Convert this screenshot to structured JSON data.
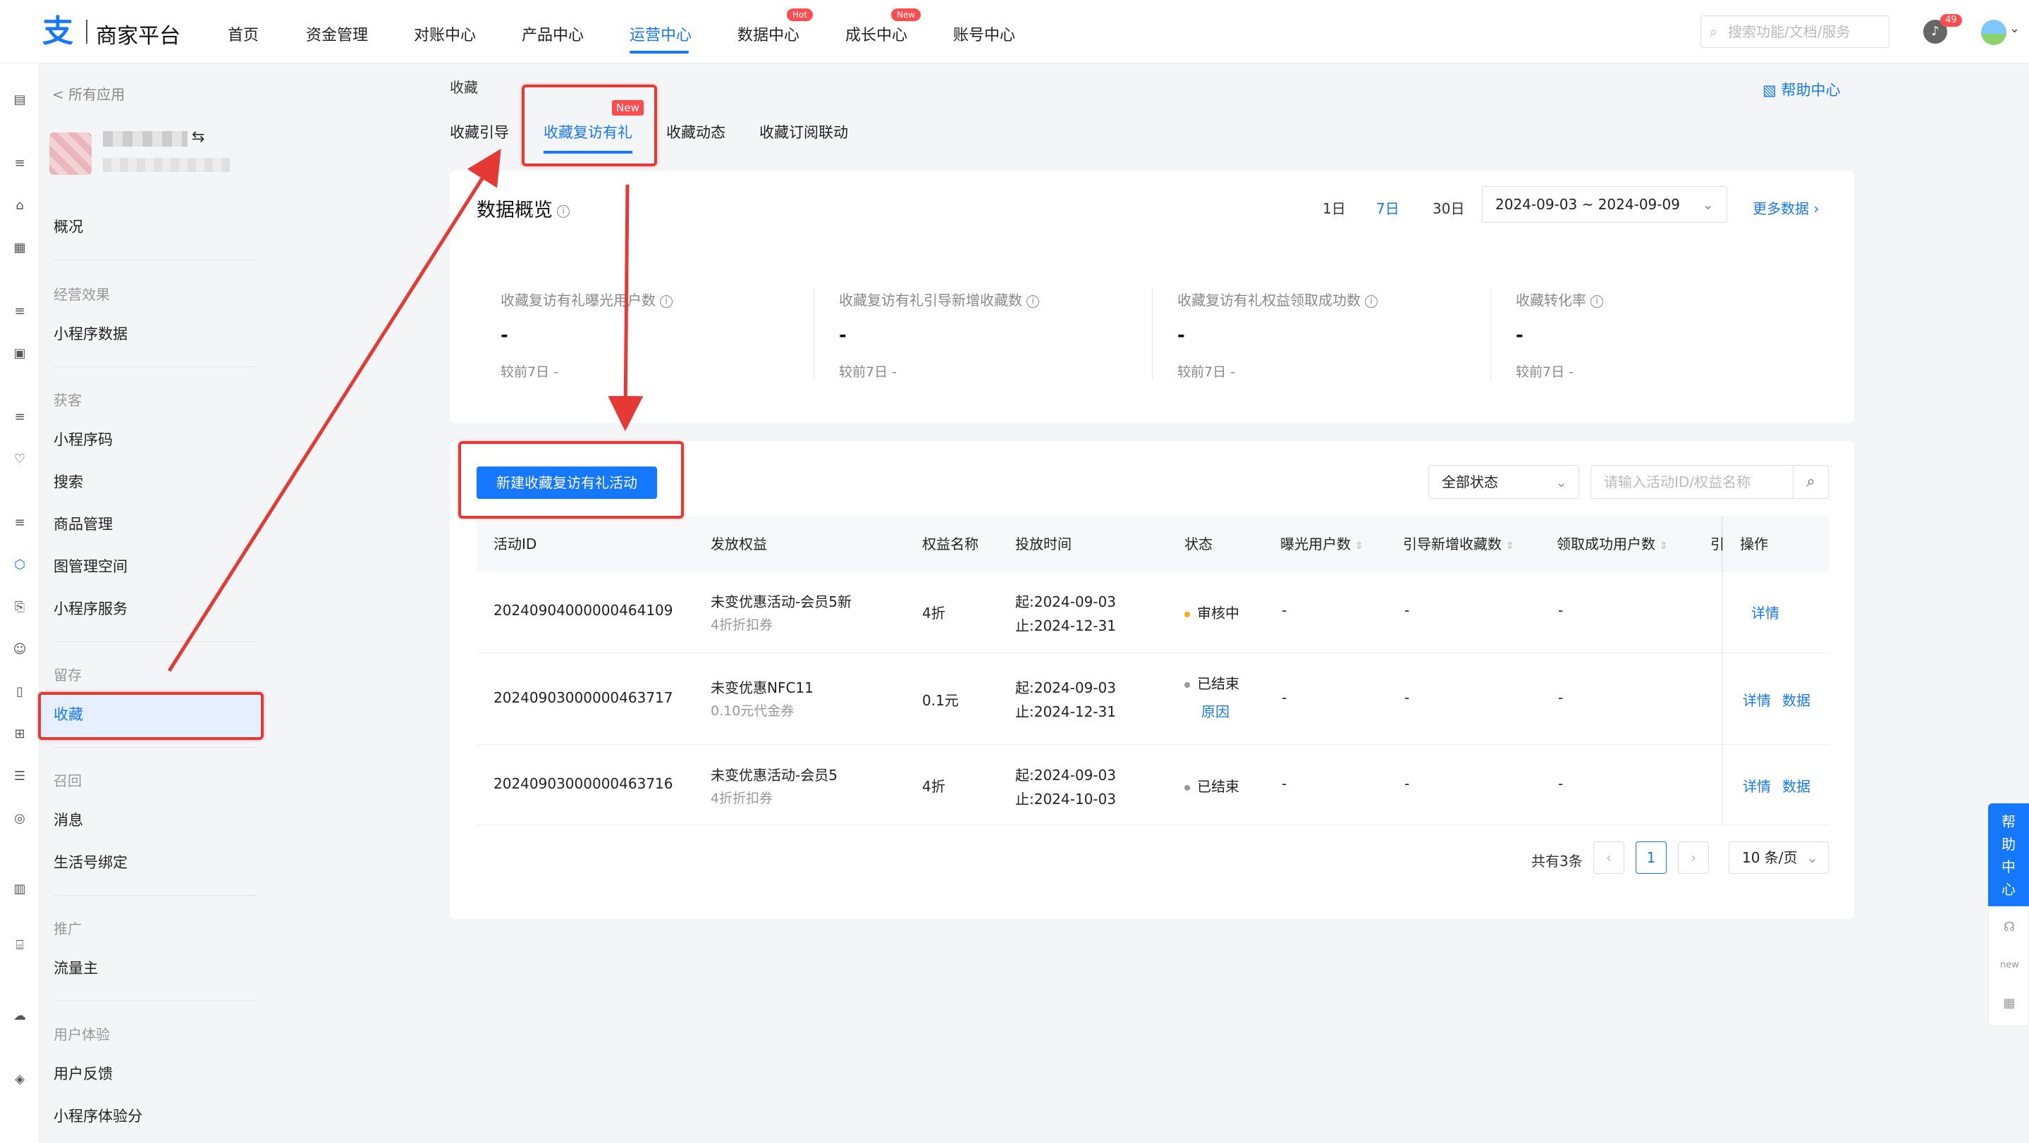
{
  "brand": {
    "mark": "支",
    "name": "商家平台",
    "color": "#1677ff"
  },
  "nav": {
    "items": [
      "首页",
      "资金管理",
      "对账中心",
      "产品中心",
      "运营中心",
      "数据中心",
      "成长中心",
      "账号中心"
    ],
    "active": "运营中心",
    "badges": {
      "data_center": "Hot",
      "growth_center": "New"
    }
  },
  "top": {
    "search_placeholder": "搜索功能/文档/服务",
    "notification_count": "49"
  },
  "sidebar": {
    "back": "< 所有应用",
    "overview": "概况",
    "groups": {
      "effect": {
        "title": "经营效果",
        "items": [
          "小程序数据"
        ]
      },
      "acquire": {
        "title": "获客",
        "items": [
          "小程序码",
          "搜索",
          "商品管理",
          "图管理空间",
          "小程序服务"
        ]
      },
      "retain": {
        "title": "留存",
        "items": [
          "收藏"
        ]
      },
      "recall": {
        "title": "召回",
        "items": [
          "消息",
          "生活号绑定"
        ]
      },
      "promote": {
        "title": "推广",
        "items": [
          "流量主"
        ]
      },
      "ux": {
        "title": "用户体验",
        "items": [
          "用户反馈",
          "小程序体验分"
        ]
      }
    },
    "active": "收藏"
  },
  "page": {
    "title": "收藏",
    "tabs": [
      "收藏引导",
      "收藏复访有礼",
      "收藏动态",
      "收藏订阅联动"
    ],
    "active_tab": "收藏复访有礼",
    "tab_badge": "New",
    "help": "帮助中心"
  },
  "overview": {
    "title": "数据概览",
    "ranges": [
      "1日",
      "7日",
      "30日"
    ],
    "active_range": "7日",
    "date_range": "2024-09-03 ~ 2024-09-09",
    "more": "更多数据",
    "metrics": [
      {
        "label": "收藏复访有礼曝光用户数",
        "value": "-",
        "compare": "较前7日 -"
      },
      {
        "label": "收藏复访有礼引导新增收藏数",
        "value": "-",
        "compare": "较前7日 -"
      },
      {
        "label": "收藏复访有礼权益领取成功数",
        "value": "-",
        "compare": "较前7日 -"
      },
      {
        "label": "收藏转化率",
        "value": "-",
        "compare": "较前7日 -"
      }
    ]
  },
  "activities": {
    "create_button": "新建收藏复访有礼活动",
    "status_filter": "全部状态",
    "search_placeholder": "请输入活动ID/权益名称",
    "columns": [
      "活动ID",
      "发放权益",
      "权益名称",
      "投放时间",
      "状态",
      "曝光用户数",
      "引导新增收藏数",
      "领取成功用户数",
      "引",
      "操作"
    ],
    "rows": [
      {
        "id": "20240904000000464109",
        "benefit": "未变优惠活动-会员5新",
        "benefit_sub": "4折折扣券",
        "name": "4折",
        "start": "起:2024-09-03",
        "end": "止:2024-12-31",
        "status": "审核中",
        "status_color": "#faad14",
        "reason": "",
        "exposure": "-",
        "new_fav": "-",
        "claimed": "-",
        "actions": [
          "详情"
        ]
      },
      {
        "id": "20240903000000463717",
        "benefit": "未变优惠NFC11",
        "benefit_sub": "0.10元代金券",
        "name": "0.1元",
        "start": "起:2024-09-03",
        "end": "止:2024-12-31",
        "status": "已结束",
        "status_color": "#999999",
        "reason": "原因",
        "exposure": "-",
        "new_fav": "-",
        "claimed": "-",
        "actions": [
          "详情",
          "数据"
        ]
      },
      {
        "id": "20240903000000463716",
        "benefit": "未变优惠活动-会员5",
        "benefit_sub": "4折折扣券",
        "name": "4折",
        "start": "起:2024-09-03",
        "end": "止:2024-10-03",
        "status": "已结束",
        "status_color": "#999999",
        "reason": "",
        "exposure": "-",
        "new_fav": "-",
        "claimed": "-",
        "actions": [
          "详情",
          "数据"
        ]
      }
    ],
    "pagination": {
      "total": "共有3条",
      "current": "1",
      "page_size": "10 条/页"
    }
  },
  "float_help": {
    "label": "帮助中心",
    "chars": [
      "帮",
      "助",
      "中",
      "心"
    ]
  },
  "annotation_color": "#e53935"
}
